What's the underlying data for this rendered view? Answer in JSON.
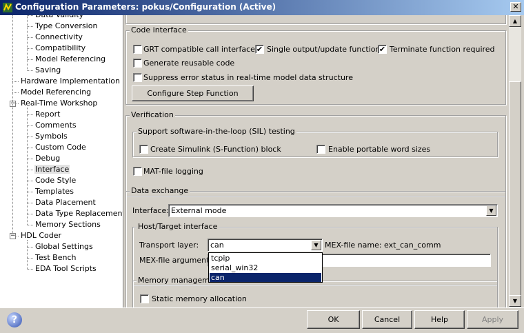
{
  "window": {
    "title": "Configuration Parameters: pokus/Configuration (Active)",
    "close_glyph": "✕"
  },
  "tree": {
    "items": [
      {
        "label": "Data Validity",
        "selected": false
      },
      {
        "label": "Type Conversion",
        "selected": false
      },
      {
        "label": "Connectivity",
        "selected": false
      },
      {
        "label": "Compatibility",
        "selected": false
      },
      {
        "label": "Model Referencing",
        "selected": false
      },
      {
        "label": "Saving",
        "selected": false
      },
      {
        "label": "Hardware Implementation",
        "selected": false
      },
      {
        "label": "Model Referencing",
        "selected": false
      },
      {
        "label": "Real-Time Workshop",
        "selected": false,
        "expander": "−"
      },
      {
        "label": "Report",
        "selected": false
      },
      {
        "label": "Comments",
        "selected": false
      },
      {
        "label": "Symbols",
        "selected": false
      },
      {
        "label": "Custom Code",
        "selected": false
      },
      {
        "label": "Debug",
        "selected": false
      },
      {
        "label": "Interface",
        "selected": true
      },
      {
        "label": "Code Style",
        "selected": false
      },
      {
        "label": "Templates",
        "selected": false
      },
      {
        "label": "Data Placement",
        "selected": false
      },
      {
        "label": "Data Type Replacement",
        "selected": false
      },
      {
        "label": "Memory Sections",
        "selected": false
      },
      {
        "label": "HDL Coder",
        "selected": false,
        "expander": "−"
      },
      {
        "label": "Global Settings",
        "selected": false
      },
      {
        "label": "Test Bench",
        "selected": false
      },
      {
        "label": "EDA Tool Scripts",
        "selected": false
      }
    ]
  },
  "code_interface": {
    "title": "Code interface",
    "grt_call": {
      "label": "GRT compatible call interface",
      "checked": false
    },
    "single_output": {
      "label": "Single output/update function",
      "checked": true
    },
    "terminate": {
      "label": "Terminate function required",
      "checked": true
    },
    "reusable": {
      "label": "Generate reusable code",
      "checked": false
    },
    "suppress": {
      "label": "Suppress error status in real-time model data structure",
      "checked": false
    },
    "step_button": "Configure Step Function",
    "check_glyph": "✔"
  },
  "verification": {
    "title": "Verification",
    "sil_title": "Support software-in-the-loop (SIL) testing",
    "sfunction": {
      "label": "Create Simulink (S-Function) block",
      "checked": false
    },
    "portable": {
      "label": "Enable portable word sizes",
      "checked": false
    },
    "matfile": {
      "label": "MAT-file logging",
      "checked": false
    }
  },
  "data_exchange": {
    "title": "Data exchange",
    "interface_label": "Interface:",
    "interface_value": "External mode",
    "host_target_title": "Host/Target interface",
    "transport_label": "Transport layer:",
    "transport_value": "can",
    "mex_name_label": "MEX-file name: ext_can_comm",
    "mex_args_label": "MEX-file arguments:",
    "mex_args_value": "",
    "transport_options": [
      "tcpip",
      "serial_win32",
      "can"
    ],
    "transport_selected_index": 2,
    "memory_title": "Memory management",
    "static_alloc": {
      "label": "Static memory allocation",
      "checked": false
    },
    "dropdown_glyph": "▼"
  },
  "scrollbar": {
    "up_glyph": "▲",
    "down_glyph": "▼"
  },
  "buttons": {
    "ok": "OK",
    "cancel": "Cancel",
    "help": "Help",
    "apply": "Apply",
    "help_icon": "?"
  }
}
